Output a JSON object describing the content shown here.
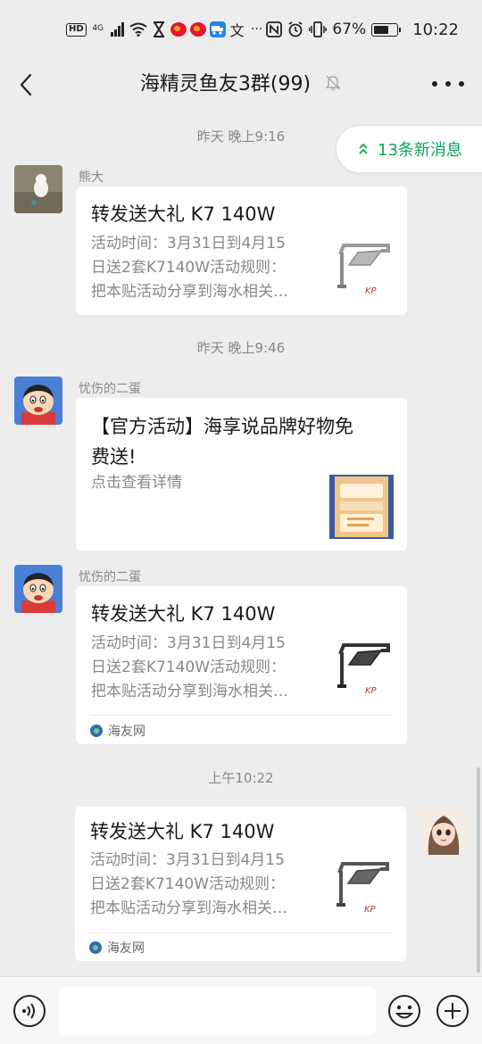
{
  "status_bar": {
    "network": "4G",
    "battery": "67%",
    "battery_level": 0.67,
    "time": "10:22",
    "hd_label": "HD",
    "app_label": "文"
  },
  "header": {
    "title": "海精灵鱼友3群(99)"
  },
  "new_messages": "13条新消息",
  "messages": [
    {
      "timestamp": "昨天 晚上9:16",
      "sender": "熊大",
      "title": "转发送大礼 K7 140W",
      "desc": "活动时间：3月31日到4月15\n日送2套K7140W活动规则：\n把本贴活动分享到海水相关…",
      "thumb_text": "KP"
    },
    {
      "timestamp": "昨天 晚上9:46",
      "sender": "忧伤的二蛋",
      "title": "【官方活动】海享说品牌好物免\n费送!",
      "desc": "点击查看详情"
    },
    {
      "sender": "忧伤的二蛋",
      "title": "转发送大礼 K7 140W",
      "desc": "活动时间：3月31日到4月15\n日送2套K7140W活动规则：\n把本贴活动分享到海水相关…",
      "thumb_text": "KP",
      "source": "海友网"
    },
    {
      "timestamp": "上午10:22",
      "title": "转发送大礼 K7 140W",
      "desc": "活动时间：3月31日到4月15\n日送2套K7140W活动规则：\n把本贴活动分享到海水相关…",
      "thumb_text": "KP",
      "source": "海友网"
    }
  ],
  "colors": {
    "background": "#ededed",
    "bubble": "#ffffff",
    "accent_green": "#07a65a",
    "meta_text": "#888888"
  }
}
